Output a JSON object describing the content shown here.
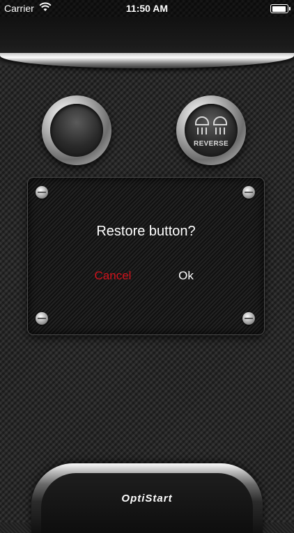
{
  "status_bar": {
    "carrier": "Carrier",
    "time": "11:50 AM",
    "wifi_icon": "wifi-icon",
    "battery_icon": "battery-icon"
  },
  "buttons": {
    "left_icon": "blank-round-button",
    "right_label": "REVERSE",
    "right_icon": "reverse-lights-icon"
  },
  "dialog": {
    "title": "Restore button?",
    "cancel_label": "Cancel",
    "ok_label": "Ok"
  },
  "brand": {
    "logo_text": "OptiStart"
  },
  "colors": {
    "cancel": "#d0121b",
    "text": "#ffffff",
    "background": "#242424"
  }
}
